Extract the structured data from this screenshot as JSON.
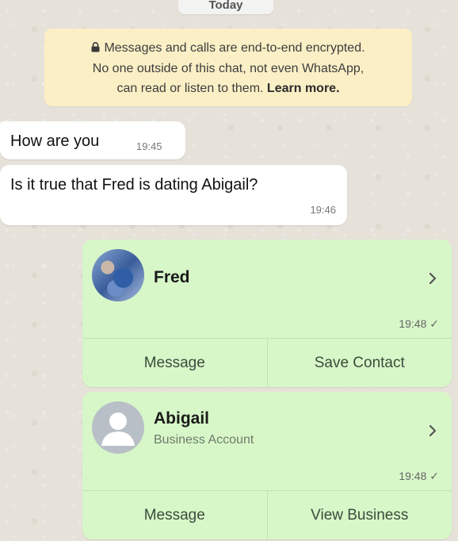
{
  "date_pill": "Today",
  "encryption": {
    "line1": "Messages and calls are end-to-end encrypted.",
    "line2": "No one outside of this chat, not even WhatsApp,",
    "line3": "can read or listen to them.",
    "learn_more": "Learn more.",
    "icon": "lock-icon"
  },
  "messages": [
    {
      "text": "How are you",
      "time": "19:45"
    },
    {
      "text": "Is it true that Fred is dating Abigail?",
      "time": "19:46"
    }
  ],
  "contacts": [
    {
      "name": "Fred",
      "subtitle": "",
      "time": "19:48 ✓",
      "actions": [
        "Message",
        "Save Contact"
      ],
      "avatar": "photo"
    },
    {
      "name": "Abigail",
      "subtitle": "Business Account",
      "time": "19:48 ✓",
      "actions": [
        "Message",
        "View Business"
      ],
      "avatar": "default-person-icon"
    }
  ],
  "colors": {
    "incoming_bubble": "#ffffff",
    "outgoing_bubble": "#d7f7c8",
    "encryption_notice": "#fbefc6",
    "chat_background": "#e6e1d9"
  }
}
